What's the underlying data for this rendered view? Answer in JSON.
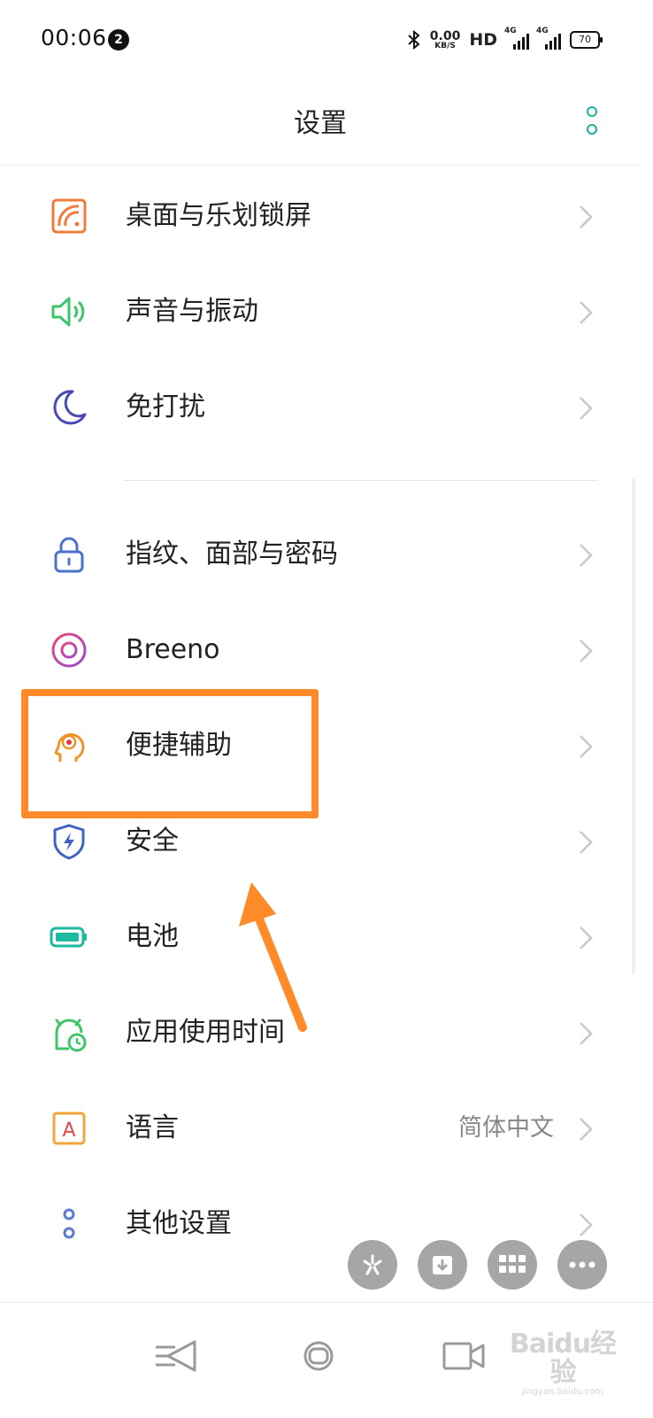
{
  "status_bar": {
    "time": "00:06",
    "notification_count": "2",
    "net_speed_value": "0.00",
    "net_speed_unit": "KB/S",
    "hd_label": "HD",
    "sim1_label": "4G",
    "sim2_label": "4G",
    "battery_level": "70",
    "icons": [
      "bluetooth-icon",
      "hd-icon",
      "signal-icon",
      "signal-icon",
      "battery-icon"
    ]
  },
  "header": {
    "title": "设置",
    "menu_icon": "more-vertical-icon"
  },
  "settings_groups": [
    {
      "items": [
        {
          "label": "桌面与乐划锁屏",
          "icon": "wallpaper-icon",
          "color": "#f07c3c"
        },
        {
          "label": "声音与振动",
          "icon": "speaker-icon",
          "color": "#3ec56a"
        },
        {
          "label": "免打扰",
          "icon": "moon-icon",
          "color": "#4a4ab5"
        }
      ]
    },
    {
      "items": [
        {
          "label": "指纹、面部与密码",
          "icon": "lock-icon",
          "color": "#4a74c9"
        },
        {
          "label": "Breeno",
          "icon": "breeno-icon",
          "color": "#c44bc8"
        },
        {
          "label": "便捷辅助",
          "icon": "assist-head-icon",
          "color": "#f0932a"
        },
        {
          "label": "安全",
          "icon": "shield-icon",
          "color": "#3f62c4"
        },
        {
          "label": "电池",
          "icon": "battery-icon",
          "color": "#1db9a0"
        },
        {
          "label": "应用使用时间",
          "icon": "usage-clock-icon",
          "color": "#3ec56a"
        },
        {
          "label": "语言",
          "icon": "language-icon",
          "color": "#f2a33a",
          "value": "简体中文",
          "icon_letter": "A"
        },
        {
          "label": "其他设置",
          "icon": "more-dots-icon",
          "color": "#5a7bd2"
        }
      ]
    }
  ],
  "floating_buttons": [
    "asterisk-icon",
    "download-icon",
    "grid-icon",
    "more-horizontal-icon"
  ],
  "nav_bar": [
    "back-icon",
    "home-icon",
    "recents-icon"
  ],
  "annotation": {
    "highlight_color": "#ff8a2a",
    "highlight_target": "便捷辅助"
  },
  "watermark": {
    "logo_text": "Baidu经验",
    "url_text": "jingyan.baidu.com"
  }
}
